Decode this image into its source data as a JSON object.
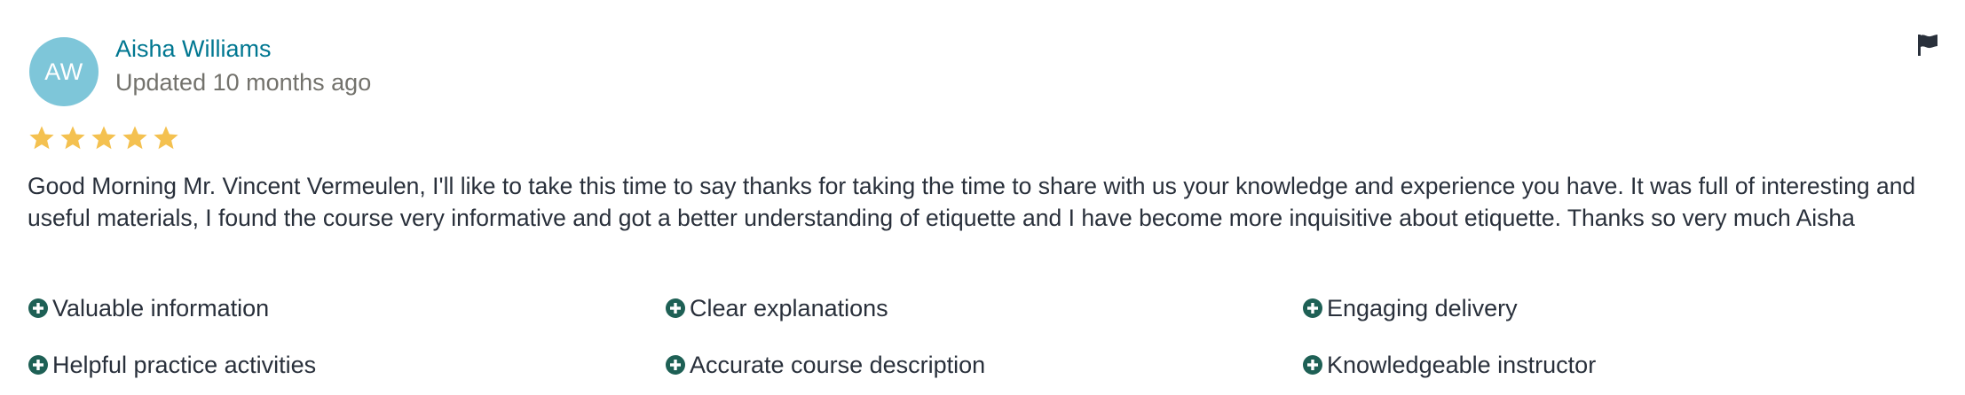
{
  "review": {
    "avatar_initials": "AW",
    "avatar_color": "#7ec6d9",
    "reviewer_name": "Aisha Williams",
    "updated": "Updated 10 months ago",
    "rating": 5,
    "rating_max": 5,
    "star_color": "#f4c150",
    "comment": "Good Morning Mr. Vincent Vermeulen, I'll like to take this time to say thanks for taking the time to share with us your knowledge and experience you have. It was full of interesting and useful materials, I found the course very informative and got a better understanding of etiquette and I have become more inquisitive about etiquette. Thanks so very much Aisha",
    "report_icon": "flag-icon",
    "tag_icon": "plus-circle-icon",
    "tag_icon_color": "#1e6055",
    "tags": [
      "Valuable information",
      "Clear explanations",
      "Engaging delivery",
      "Helpful practice activities",
      "Accurate course description",
      "Knowledgeable instructor"
    ]
  }
}
